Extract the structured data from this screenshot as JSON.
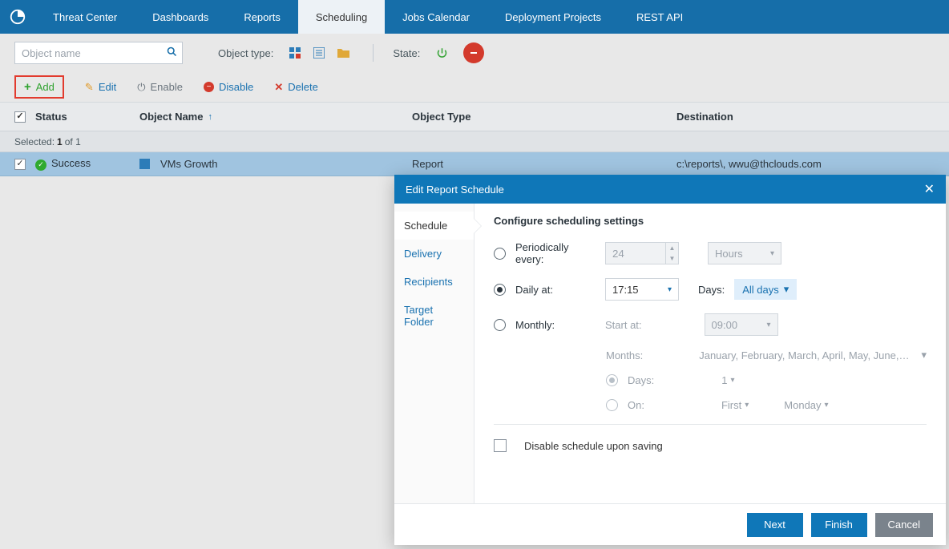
{
  "nav": {
    "items": [
      "Threat Center",
      "Dashboards",
      "Reports",
      "Scheduling",
      "Jobs Calendar",
      "Deployment Projects",
      "REST API"
    ],
    "active_index": 3
  },
  "filter": {
    "search_placeholder": "Object name",
    "object_type_label": "Object type:",
    "state_label": "State:"
  },
  "actions": {
    "add": "Add",
    "edit": "Edit",
    "enable": "Enable",
    "disable": "Disable",
    "delete": "Delete"
  },
  "table": {
    "cols": {
      "status": "Status",
      "object_name": "Object Name",
      "object_type": "Object Type",
      "destination": "Destination"
    },
    "selected_label": "Selected:",
    "selected_count": "1",
    "selected_total": "of 1",
    "rows": [
      {
        "status": "Success",
        "name": "VMs Growth",
        "type": "Report",
        "dest": "c:\\reports\\, wwu@thclouds.com"
      }
    ]
  },
  "modal": {
    "title": "Edit Report Schedule",
    "sidebar": [
      "Schedule",
      "Delivery",
      "Recipients",
      "Target Folder"
    ],
    "active_index": 0,
    "section_title": "Configure scheduling settings",
    "periodically": {
      "label": "Periodically every:",
      "value": "24",
      "unit": "Hours"
    },
    "daily": {
      "label": "Daily at:",
      "time": "17:15",
      "days_label": "Days:",
      "days_value": "All days"
    },
    "monthly": {
      "label": "Monthly:",
      "start_label": "Start at:",
      "start_value": "09:00",
      "months_label": "Months:",
      "months_value": "January, February, March, April, May, June, July, August, Septe...",
      "days_opt_label": "Days:",
      "days_opt_value": "1",
      "on_label": "On:",
      "on_ord": "First",
      "on_dow": "Monday"
    },
    "disable_chk": "Disable schedule upon saving",
    "buttons": {
      "next": "Next",
      "finish": "Finish",
      "cancel": "Cancel"
    }
  }
}
